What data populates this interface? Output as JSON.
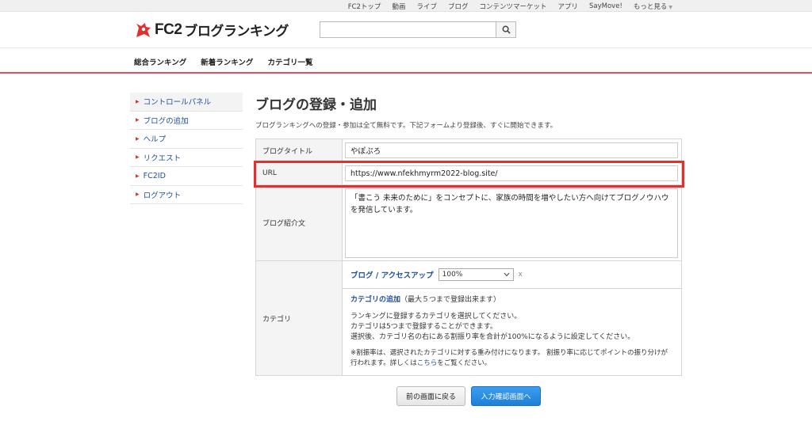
{
  "topnav": {
    "items": [
      "FC2トップ",
      "動画",
      "ライブ",
      "ブログ",
      "コンテンツマーケット",
      "アプリ",
      "SayMove!",
      "もっと見る"
    ]
  },
  "header": {
    "logo_fc2": "FC2",
    "logo_text": "ブログランキング",
    "search_value": "",
    "brand_color": "#e03030"
  },
  "mainnav": {
    "items": [
      "総合ランキング",
      "新着ランキング",
      "カテゴリ一覧"
    ]
  },
  "sidebar": {
    "items": [
      "コントロールパネル",
      "ブログの追加",
      "ヘルプ",
      "リクエスト",
      "FC2ID",
      "ログアウト"
    ]
  },
  "main": {
    "title": "ブログの登録・追加",
    "intro": "ブログランキングへの登録・参加は全て無料です。下記フォームより登録後、すぐに開始できます。"
  },
  "form": {
    "blog_title_label": "ブログタイトル",
    "blog_title_value": "やぽぷろ",
    "url_label": "URL",
    "url_value": "https://www.nfekhmyrm2022-blog.site/",
    "desc_label": "ブログ紹介文",
    "desc_value": "「書こう 未来のために」をコンセプトに、家族の時間を増やしたい方へ向けてブログノウハウを発信しています。",
    "category_label": "カテゴリ",
    "category": {
      "name": "ブログ / アクセスアップ",
      "ratio": "100%",
      "remove": "x",
      "add_link": "カテゴリの追加",
      "add_note": "（最大５つまで登録出来ます）",
      "help1": "ランキングに登録するカテゴリを選択してください。",
      "help2": "カテゴリは5つまで登録することができます。",
      "help3": "選択後、カテゴリ名の右にある割振り率を合計が100%になるように設定してください。",
      "note_before": "※割振率は、選択されたカテゴリに対する重み付けになります。 割振り率に応じてポイントの振り分けが行われます。詳しくは",
      "note_link": "こちら",
      "note_after": "をご覧ください。"
    }
  },
  "buttons": {
    "back": "前の画面に戻る",
    "next": "入力確認画面へ"
  },
  "highlight_color": "#e82d2d"
}
